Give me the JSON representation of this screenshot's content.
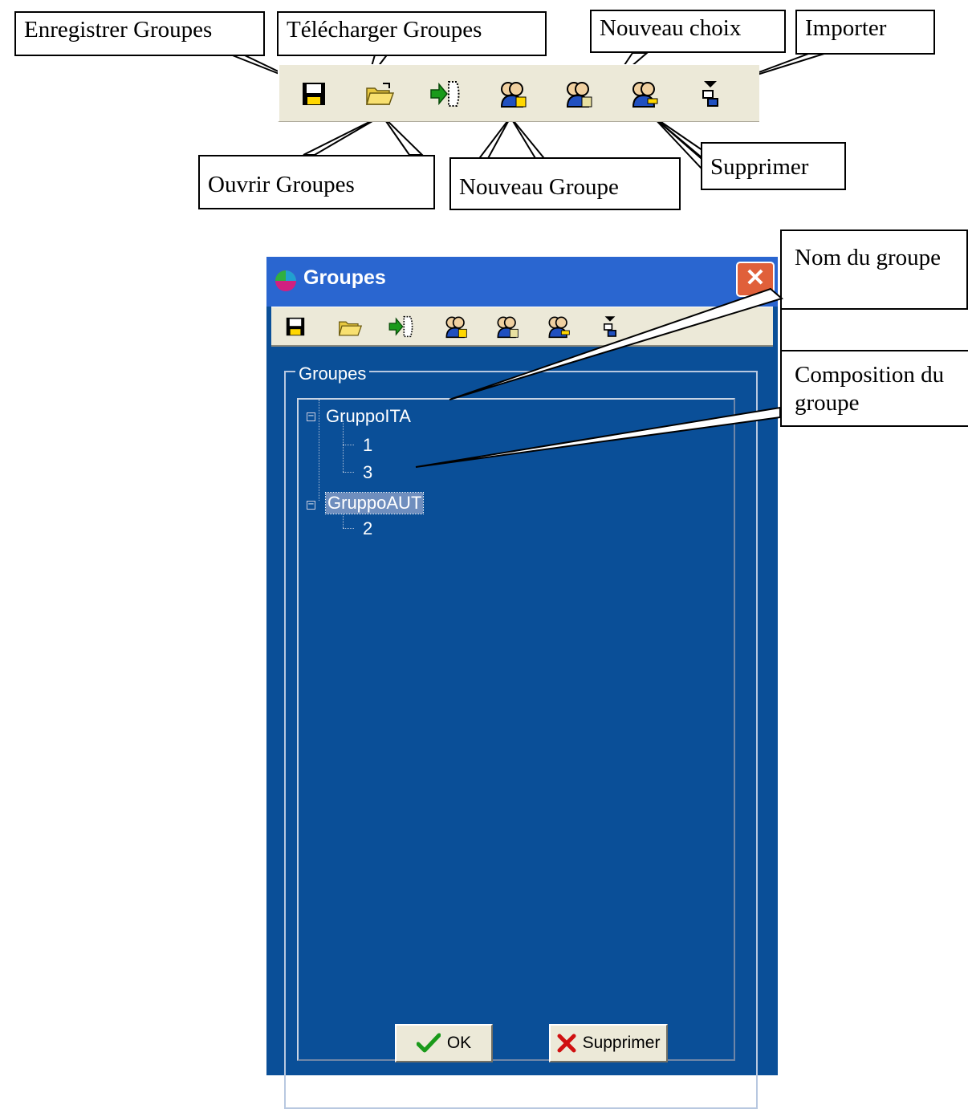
{
  "callouts": {
    "save": "Enregistrer Groupes",
    "download": "Télécharger Groupes",
    "new_choice": "Nouveau choix",
    "import": "Importer",
    "open": "Ouvrir Groupes",
    "new_group": "Nouveau Groupe",
    "delete": "Supprimer",
    "group_name": "Nom du groupe",
    "group_composition": "Composition du groupe"
  },
  "toolbar_icons": [
    "save-icon",
    "open-folder-icon",
    "download-arrow-icon",
    "new-group-icon",
    "new-choice-icon",
    "delete-group-icon",
    "import-icon"
  ],
  "window": {
    "title": "Groupes",
    "close_label": "✕",
    "groupbox_label": "Groupes",
    "tree": [
      {
        "label": "GruppoITA",
        "children": [
          "1",
          "3"
        ],
        "selected": false
      },
      {
        "label": "GruppoAUT",
        "children": [
          "2"
        ],
        "selected": true
      }
    ],
    "ok_label": "OK",
    "cancel_label": "Supprimer"
  },
  "colors": {
    "window_bg": "#0a4f98",
    "titlebar": "#2a66d0",
    "toolbar": "#ece9d8",
    "close_button": "#e0603a"
  }
}
